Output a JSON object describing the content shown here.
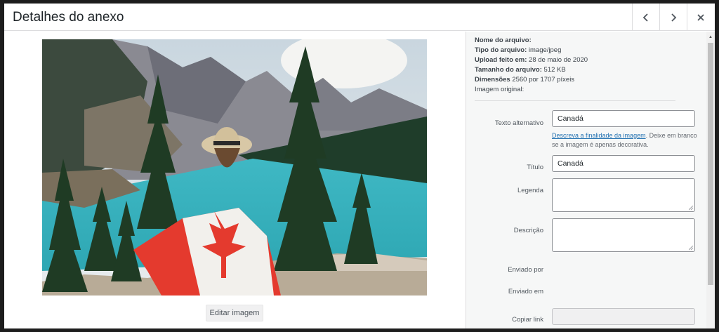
{
  "modal": {
    "title": "Detalhes do anexo"
  },
  "header_buttons": {
    "prev_icon": "chevron-left-icon",
    "next_icon": "chevron-right-icon",
    "close_icon": "close-icon"
  },
  "preview": {
    "edit_label": "Editar imagem"
  },
  "details": {
    "filename_label": "Nome do arquivo:",
    "filename_value": "",
    "type_label": "Tipo do arquivo:",
    "type_value": " image/jpeg",
    "uploaded_label": "Upload feito em:",
    "uploaded_value": " 28 de maio de 2020",
    "size_label": "Tamanho do arquivo:",
    "size_value": " 512 KB",
    "dimensions_label": "Dimensões",
    "dimensions_value": " 2560 por 1707 píxeis",
    "original_label": "Imagem original:"
  },
  "form": {
    "alt_label": "Texto alternativo",
    "alt_value": "Canadá",
    "help_link": "Descreva a finalidade da imagem",
    "help_text": ". Deixe em branco se a imagem é apenas decorativa.",
    "title_label": "Título",
    "title_value": "Canadá",
    "caption_label": "Legenda",
    "caption_value": "",
    "description_label": "Descrição",
    "description_value": "",
    "sent_by_label": "Enviado por",
    "sent_in_label": "Enviado em",
    "copy_link_label": "Copiar link",
    "copy_link_value": ""
  }
}
